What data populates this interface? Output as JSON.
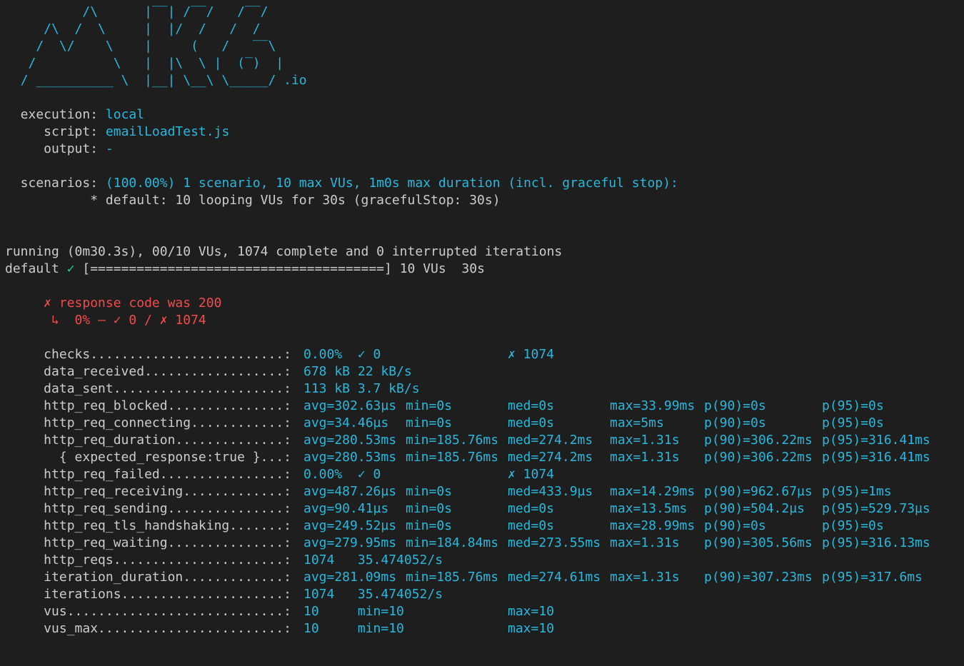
{
  "logo": {
    "lines": [
      "          /\\      |‾‾| /‾‾/   /‾‾/",
      "     /\\  /  \\     |  |/  /   /  /",
      "    /  \\/    \\    |     (   /   ‾‾\\",
      "   /          \\   |  |\\  \\ |  (‾)  |",
      "  / __________ \\  |__| \\__\\ \\_____/ .io"
    ]
  },
  "options": {
    "execution": {
      "label": "  execution: ",
      "value": "local"
    },
    "script": {
      "label": "     script: ",
      "value": "emailLoadTest.js"
    },
    "output": {
      "label": "     output: ",
      "value": "-"
    },
    "scenarios": {
      "label": "  scenarios: ",
      "value": "(100.00%) 1 scenario, 10 max VUs, 1m0s max duration (incl. graceful stop):"
    },
    "default_scenario": "           * default: 10 looping VUs for 30s (gracefulStop: 30s)"
  },
  "progress": {
    "running": "running (0m30.3s), 00/10 VUs, 1074 complete and 0 interrupted iterations",
    "default_label": "default ",
    "check_mark": "✓",
    "bar": " [======================================] 10 VUs  30s"
  },
  "checks_detail": {
    "title": "     ✗ response code was 200",
    "sub": "      ↳  0% — ✓ 0 / ✗ 1074"
  },
  "metrics": [
    {
      "name": "     checks.........................: ",
      "values": [
        "0.00%  ✓ 0",
        "",
        "✗ 1074",
        "",
        "",
        ""
      ]
    },
    {
      "name": "     data_received..................: ",
      "values": [
        "678 kB 22 kB/s",
        "",
        "",
        "",
        "",
        ""
      ]
    },
    {
      "name": "     data_sent......................: ",
      "values": [
        "113 kB 3.7 kB/s",
        "",
        "",
        "",
        "",
        ""
      ]
    },
    {
      "name": "     http_req_blocked...............: ",
      "values": [
        "avg=302.63µs",
        "min=0s",
        "med=0s",
        "max=33.99ms",
        "p(90)=0s",
        "p(95)=0s"
      ]
    },
    {
      "name": "     http_req_connecting............: ",
      "values": [
        "avg=34.46µs",
        "min=0s",
        "med=0s",
        "max=5ms",
        "p(90)=0s",
        "p(95)=0s"
      ]
    },
    {
      "name": "     http_req_duration..............: ",
      "values": [
        "avg=280.53ms",
        "min=185.76ms",
        "med=274.2ms",
        "max=1.31s",
        "p(90)=306.22ms",
        "p(95)=316.41ms"
      ]
    },
    {
      "name": "       { expected_response:true }...: ",
      "values": [
        "avg=280.53ms",
        "min=185.76ms",
        "med=274.2ms",
        "max=1.31s",
        "p(90)=306.22ms",
        "p(95)=316.41ms"
      ]
    },
    {
      "name": "     http_req_failed................: ",
      "values": [
        "0.00%  ✓ 0",
        "",
        "✗ 1074",
        "",
        "",
        ""
      ]
    },
    {
      "name": "     http_req_receiving.............: ",
      "values": [
        "avg=487.26µs",
        "min=0s",
        "med=433.9µs",
        "max=14.29ms",
        "p(90)=962.67µs",
        "p(95)=1ms"
      ]
    },
    {
      "name": "     http_req_sending...............: ",
      "values": [
        "avg=90.41µs",
        "min=0s",
        "med=0s",
        "max=13.5ms",
        "p(90)=504.2µs",
        "p(95)=529.73µs"
      ]
    },
    {
      "name": "     http_req_tls_handshaking.......: ",
      "values": [
        "avg=249.52µs",
        "min=0s",
        "med=0s",
        "max=28.99ms",
        "p(90)=0s",
        "p(95)=0s"
      ]
    },
    {
      "name": "     http_req_waiting...............: ",
      "values": [
        "avg=279.95ms",
        "min=184.84ms",
        "med=273.55ms",
        "max=1.31s",
        "p(90)=305.56ms",
        "p(95)=316.13ms"
      ]
    },
    {
      "name": "     http_reqs......................: ",
      "values": [
        "1074   35.474052/s",
        "",
        "",
        "",
        "",
        ""
      ]
    },
    {
      "name": "     iteration_duration.............: ",
      "values": [
        "avg=281.09ms",
        "min=185.76ms",
        "med=274.61ms",
        "max=1.31s",
        "p(90)=307.23ms",
        "p(95)=317.6ms"
      ]
    },
    {
      "name": "     iterations.....................: ",
      "values": [
        "1074   35.474052/s",
        "",
        "",
        "",
        "",
        ""
      ]
    },
    {
      "name": "     vus............................: ",
      "values": [
        "10     min=10",
        "",
        "max=10",
        "",
        "",
        ""
      ]
    },
    {
      "name": "     vus_max........................: ",
      "values": [
        "10     min=10",
        "",
        "max=10",
        "",
        "",
        ""
      ]
    }
  ]
}
